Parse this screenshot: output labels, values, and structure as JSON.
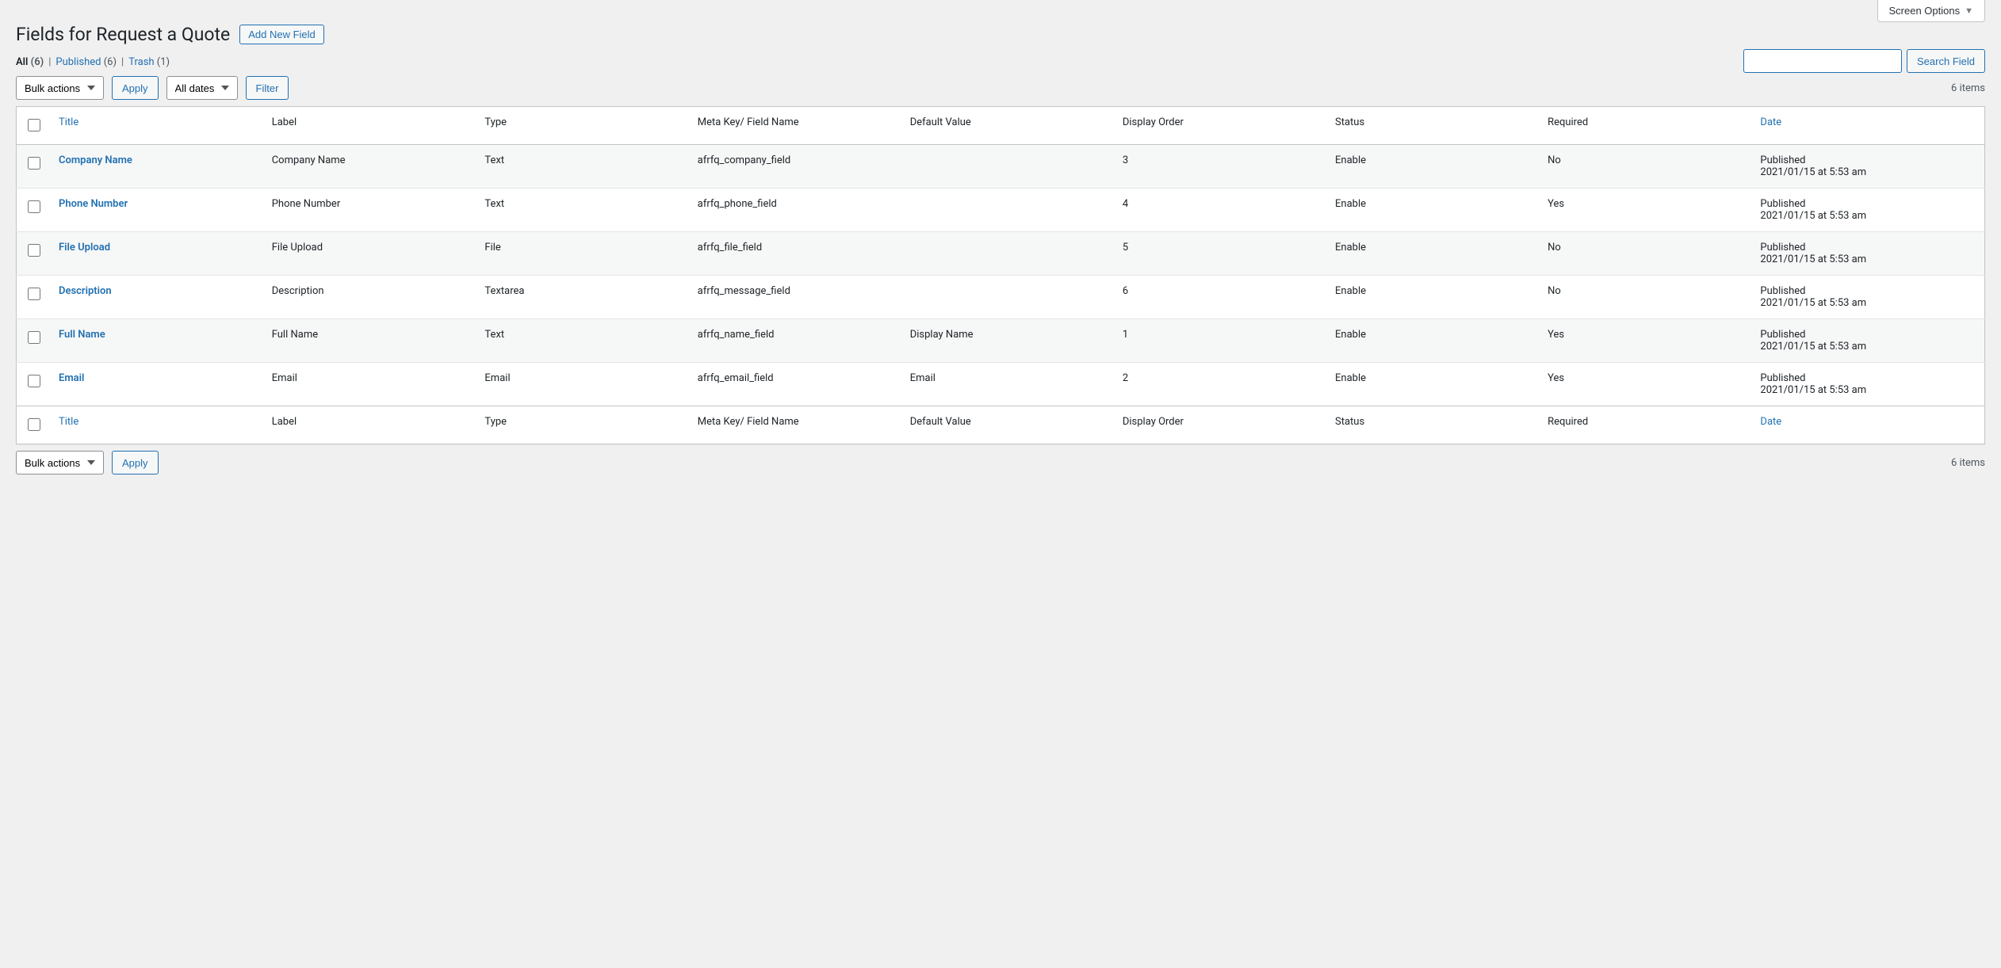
{
  "screen_options_label": "Screen Options",
  "page_title": "Fields for Request a Quote",
  "add_new_label": "Add New Field",
  "views": {
    "all_label": "All",
    "all_count": "(6)",
    "published_label": "Published",
    "published_count": "(6)",
    "trash_label": "Trash",
    "trash_count": "(1)"
  },
  "search": {
    "button_label": "Search Field",
    "value": ""
  },
  "bulk_actions": {
    "label": "Bulk actions",
    "apply_label": "Apply"
  },
  "date_filter": {
    "label": "All dates",
    "filter_label": "Filter"
  },
  "items_count": "6 items",
  "columns": {
    "title": "Title",
    "label": "Label",
    "type": "Type",
    "meta": "Meta Key/ Field Name",
    "default": "Default Value",
    "order": "Display Order",
    "status": "Status",
    "required": "Required",
    "date": "Date"
  },
  "rows": [
    {
      "title": "Company Name",
      "label": "Company Name",
      "type": "Text",
      "meta": "afrfq_company_field",
      "default": "",
      "order": "3",
      "status": "Enable",
      "required": "No",
      "date_status": "Published",
      "date_text": "2021/01/15 at 5:53 am"
    },
    {
      "title": "Phone Number",
      "label": "Phone Number",
      "type": "Text",
      "meta": "afrfq_phone_field",
      "default": "",
      "order": "4",
      "status": "Enable",
      "required": "Yes",
      "date_status": "Published",
      "date_text": "2021/01/15 at 5:53 am"
    },
    {
      "title": "File Upload",
      "label": "File Upload",
      "type": "File",
      "meta": "afrfq_file_field",
      "default": "",
      "order": "5",
      "status": "Enable",
      "required": "No",
      "date_status": "Published",
      "date_text": "2021/01/15 at 5:53 am"
    },
    {
      "title": "Description",
      "label": "Description",
      "type": "Textarea",
      "meta": "afrfq_message_field",
      "default": "",
      "order": "6",
      "status": "Enable",
      "required": "No",
      "date_status": "Published",
      "date_text": "2021/01/15 at 5:53 am"
    },
    {
      "title": "Full Name",
      "label": "Full Name",
      "type": "Text",
      "meta": "afrfq_name_field",
      "default": "Display Name",
      "order": "1",
      "status": "Enable",
      "required": "Yes",
      "date_status": "Published",
      "date_text": "2021/01/15 at 5:53 am"
    },
    {
      "title": "Email",
      "label": "Email",
      "type": "Email",
      "meta": "afrfq_email_field",
      "default": "Email",
      "order": "2",
      "status": "Enable",
      "required": "Yes",
      "date_status": "Published",
      "date_text": "2021/01/15 at 5:53 am"
    }
  ]
}
